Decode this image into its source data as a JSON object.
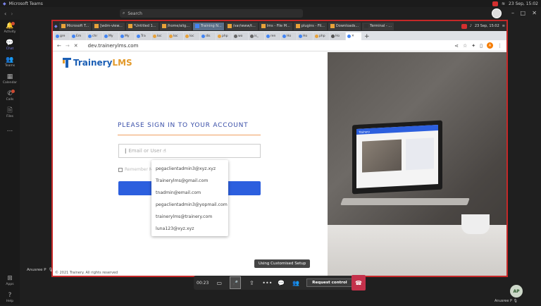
{
  "os_bar": {
    "app": "Microsoft Teams",
    "clock": "23 Sep, 15:02"
  },
  "teams": {
    "search_placeholder": "Search"
  },
  "sidebar": {
    "items": [
      {
        "label": "Activity",
        "icon": "bell-icon",
        "badge": "1"
      },
      {
        "label": "Chat",
        "icon": "chat-icon"
      },
      {
        "label": "Teams",
        "icon": "teams-icon"
      },
      {
        "label": "Calendar",
        "icon": "calendar-icon"
      },
      {
        "label": "Calls",
        "icon": "phone-icon",
        "badge": ""
      },
      {
        "label": "Files",
        "icon": "file-icon"
      },
      {
        "label": "...",
        "icon": "more-icon"
      }
    ],
    "bottom": [
      {
        "label": "Apps",
        "icon": "apps-icon"
      },
      {
        "label": "Help",
        "icon": "help-icon"
      }
    ]
  },
  "shared": {
    "taskbar_tabs": [
      "Microsoft T...",
      "[wdm-view...",
      "*Untitled 1...",
      "/home/alig...",
      "Training N...",
      "/var/www/t...",
      "lms - File M...",
      "plugins - Fil...",
      "Downloads...",
      "Terminal - ..."
    ],
    "taskbar_clock": "23 Sep, 15:02",
    "chrome_tabs": [
      "gre",
      "Em",
      "chr",
      "My",
      "My",
      "Tra",
      "loc",
      "loc",
      "loc",
      "dis",
      "php",
      "wo",
      "is_",
      "ren",
      "Ho",
      "Ho",
      "php",
      "Ho"
    ],
    "url": "dev.trainerylms.com",
    "profile_letter": "A",
    "page": {
      "logo_main": "Trainery",
      "logo_accent": "LMS",
      "signin_title": "PLEASE SIGN IN TO YOUR ACCOUNT",
      "email_placeholder": "Email or User",
      "remember_label": "Remember M",
      "autocomplete": [
        "pegaclientadmin3@xyz.xyz",
        "Trainerylms@gmail.com",
        "tnadmin@email.com",
        "pegaclientadmin3@yopmail.com",
        "trainerylms@trainery.com",
        "luna123@xyz.xyz"
      ],
      "footer": "© 2021 Trainery. All rights reserved",
      "laptop_brand": "Trainery"
    }
  },
  "tooltip": "Using Customised Setup",
  "presenter": "Anusree P",
  "call": {
    "timer": "00:23",
    "request_control": "Request control"
  },
  "self": {
    "initials": "AP",
    "name": "Anusree P"
  },
  "colors": {
    "share_border": "#c62828",
    "login_btn": "#2c5fde",
    "hangup": "#c4314b",
    "brand": "#1b5fb5",
    "accent": "#e39a2b"
  }
}
